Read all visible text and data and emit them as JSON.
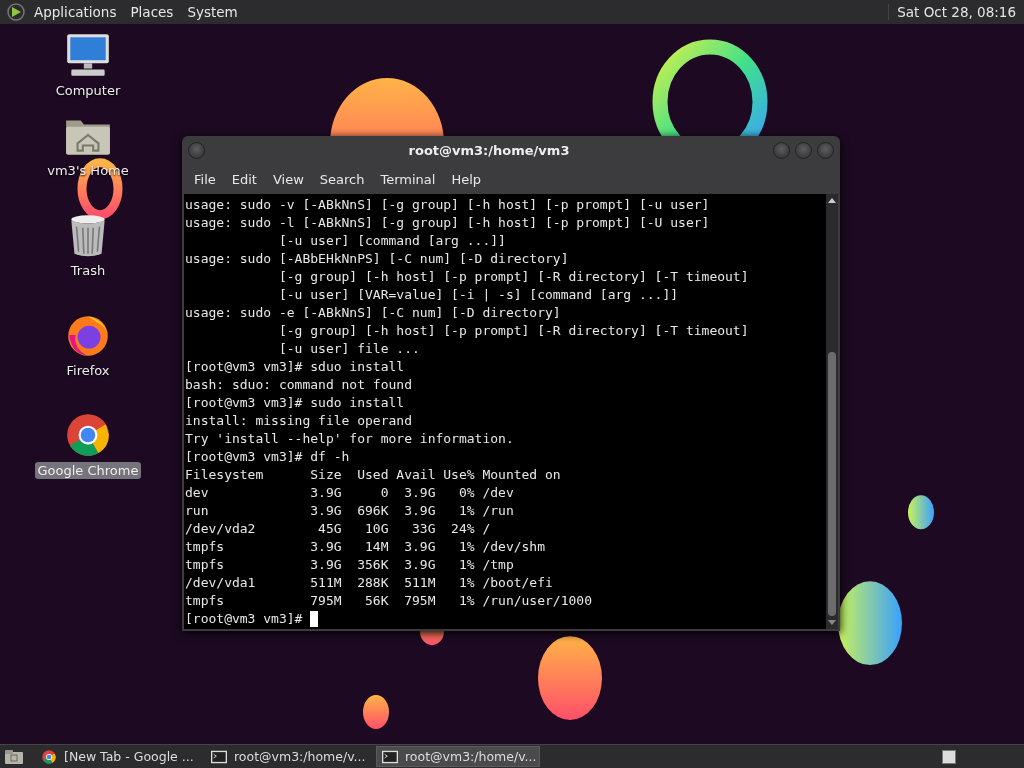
{
  "top_panel": {
    "menus": [
      "Applications",
      "Places",
      "System"
    ],
    "clock": "Sat Oct 28, 08:16"
  },
  "desktop_icons": [
    {
      "kind": "computer",
      "label": "Computer",
      "selected": false
    },
    {
      "kind": "home",
      "label": "vm3's Home",
      "selected": false
    },
    {
      "kind": "trash",
      "label": "Trash",
      "selected": false
    },
    {
      "kind": "firefox",
      "label": "Firefox",
      "selected": false
    },
    {
      "kind": "chrome",
      "label": "Google Chrome",
      "selected": true
    }
  ],
  "terminal": {
    "title": "root@vm3:/home/vm3",
    "menu": [
      "File",
      "Edit",
      "View",
      "Search",
      "Terminal",
      "Help"
    ],
    "lines": [
      "usage: sudo -v [-ABkNnS] [-g group] [-h host] [-p prompt] [-u user]",
      "usage: sudo -l [-ABkNnS] [-g group] [-h host] [-p prompt] [-U user]",
      "            [-u user] [command [arg ...]]",
      "usage: sudo [-ABbEHkNnPS] [-C num] [-D directory]",
      "            [-g group] [-h host] [-p prompt] [-R directory] [-T timeout]",
      "            [-u user] [VAR=value] [-i | -s] [command [arg ...]]",
      "usage: sudo -e [-ABkNnS] [-C num] [-D directory]",
      "            [-g group] [-h host] [-p prompt] [-R directory] [-T timeout]",
      "            [-u user] file ...",
      "[root@vm3 vm3]# sduo install",
      "bash: sduo: command not found",
      "[root@vm3 vm3]# sudo install",
      "install: missing file operand",
      "Try 'install --help' for more information.",
      "[root@vm3 vm3]# df -h",
      "Filesystem      Size  Used Avail Use% Mounted on",
      "dev             3.9G     0  3.9G   0% /dev",
      "run             3.9G  696K  3.9G   1% /run",
      "/dev/vda2        45G   10G   33G  24% /",
      "tmpfs           3.9G   14M  3.9G   1% /dev/shm",
      "tmpfs           3.9G  356K  3.9G   1% /tmp",
      "/dev/vda1       511M  288K  511M   1% /boot/efi",
      "tmpfs           795M   56K  795M   1% /run/user/1000"
    ],
    "prompt": "[root@vm3 vm3]# "
  },
  "taskbar": {
    "items": [
      {
        "kind": "chrome",
        "label": "[New Tab - Google ...",
        "selected": false
      },
      {
        "kind": "terminal",
        "label": "root@vm3:/home/v...",
        "selected": false
      },
      {
        "kind": "terminal",
        "label": "root@vm3:/home/v...",
        "selected": true
      }
    ]
  }
}
